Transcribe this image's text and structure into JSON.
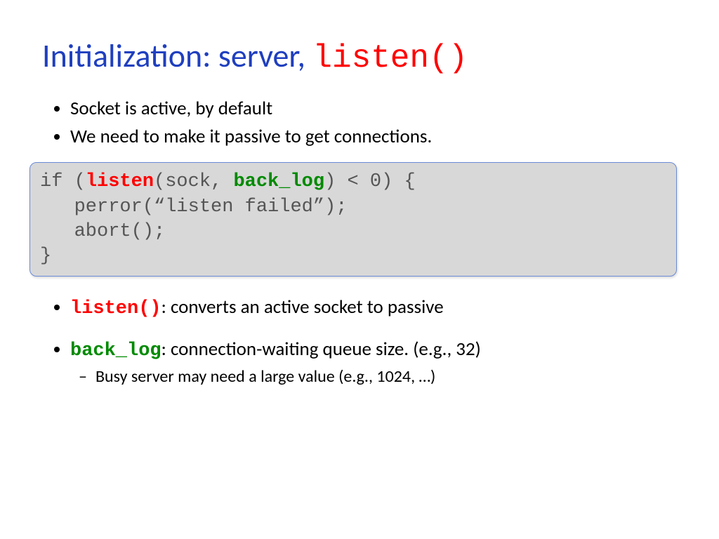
{
  "title": {
    "part1": "Initialization: server, ",
    "part2": "listen()"
  },
  "intro": [
    "Socket is active, by default",
    "We need to make it passive to get connections."
  ],
  "code": {
    "line1_a": "if (",
    "line1_listen": "listen",
    "line1_b": "(sock, ",
    "line1_backlog": "back_log",
    "line1_c": ") < 0) {",
    "line2": "   perror(“listen failed”);",
    "line3": "   abort();",
    "line4": "}"
  },
  "desc": {
    "listen_kw": "listen()",
    "listen_txt": ": converts an active socket to passive",
    "backlog_kw": "back_log",
    "backlog_txt": ": connection-waiting queue size. (e.g., 32)",
    "backlog_sub": "Busy server may need a large value (e.g., 1024, …)"
  }
}
